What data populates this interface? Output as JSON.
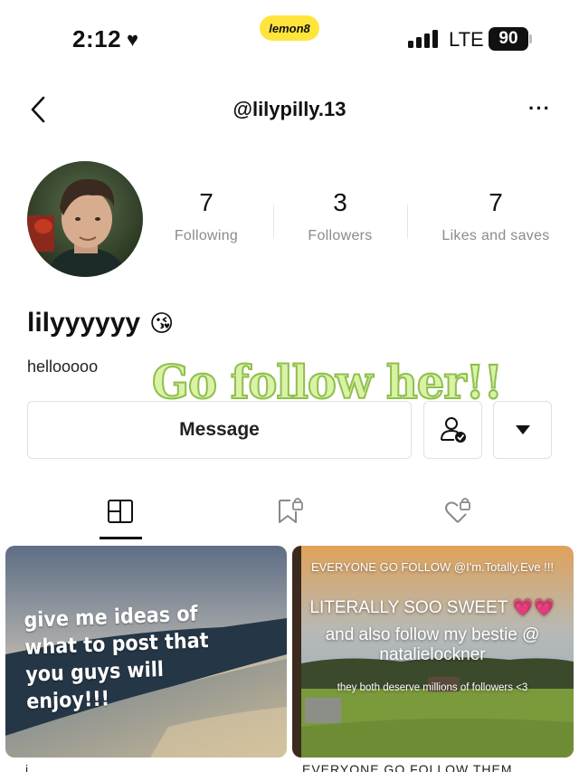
{
  "status_bar": {
    "time": "2:12",
    "app_pill": "lemon8",
    "network": "LTE",
    "battery": "90"
  },
  "header": {
    "handle": "@lilypilly.13",
    "more_icon": "ellipsis-icon",
    "back_icon": "chevron-left-icon"
  },
  "profile": {
    "stats": [
      {
        "value": "7",
        "label": "Following"
      },
      {
        "value": "3",
        "label": "Followers"
      },
      {
        "value": "7",
        "label": "Likes and saves"
      }
    ],
    "name": "lilyyyyyy",
    "name_emoji": "😘",
    "bio": "hellooooo",
    "overlay_caption": "Go follow her!!"
  },
  "actions": {
    "message_label": "Message",
    "following_icon": "user-check-icon",
    "dropdown_icon": "caret-down-icon"
  },
  "tabs": [
    {
      "name": "posts",
      "icon": "grid-icon",
      "active": true
    },
    {
      "name": "saved",
      "icon": "bookmark-lock-icon",
      "active": false
    },
    {
      "name": "liked",
      "icon": "heart-lock-icon",
      "active": false
    }
  ],
  "posts": [
    {
      "text": "give me ideas of what to post that you guys will enjoy!!!"
    },
    {
      "line1": "EVERYONE GO FOLLOW @I'm.Totally.Eve !!!",
      "line2": "LITERALLY SOO SWEET 💗💗",
      "line3": "and also follow my bestie @ natalielockner",
      "line4": "they both deserve millions of followers <3"
    }
  ],
  "peek": {
    "left": "i...",
    "right": "EVERYONE GO FOLLOW THEM"
  },
  "colors": {
    "lemon_yellow": "#ffe53b",
    "caption_fill": "#d9f2a6",
    "caption_stroke": "#8fbf4d",
    "muted_text": "#8b8b8b"
  }
}
